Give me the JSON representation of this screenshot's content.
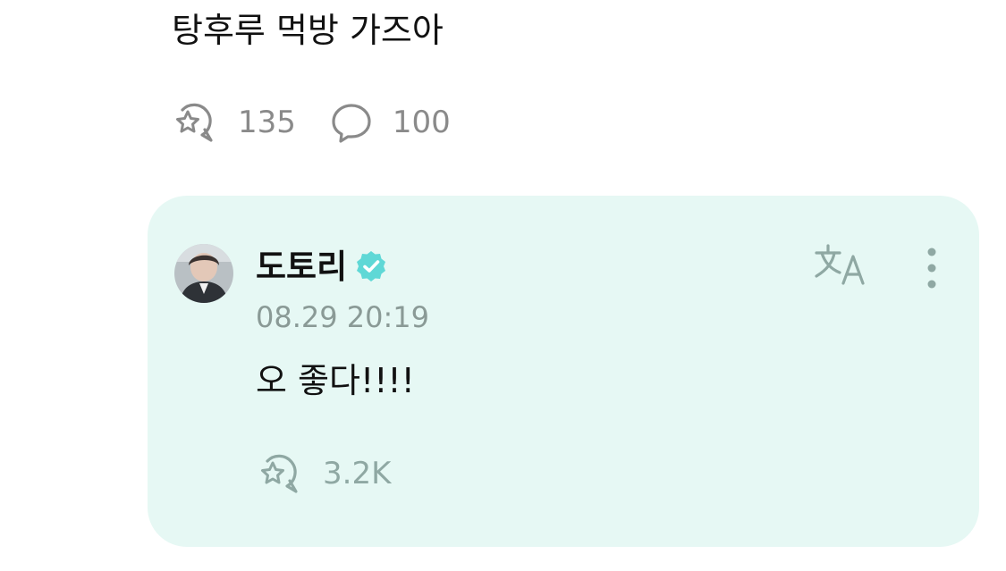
{
  "post": {
    "text": "탕후루 먹방 가즈아",
    "like_icon": "star-bubble-icon",
    "like_count": "135",
    "comment_icon": "speech-bubble-icon",
    "comment_count": "100"
  },
  "comment": {
    "background": "#e6f8f4",
    "author": "도토리",
    "verified_icon": "verified-badge-icon",
    "verified_color": "#5fd8d6",
    "timestamp": "08.29 20:19",
    "text": "오 좋다!!!!",
    "translate_icon": "translate-icon",
    "more_icon": "more-vertical-icon",
    "like_icon": "star-bubble-icon",
    "like_count": "3.2K"
  }
}
